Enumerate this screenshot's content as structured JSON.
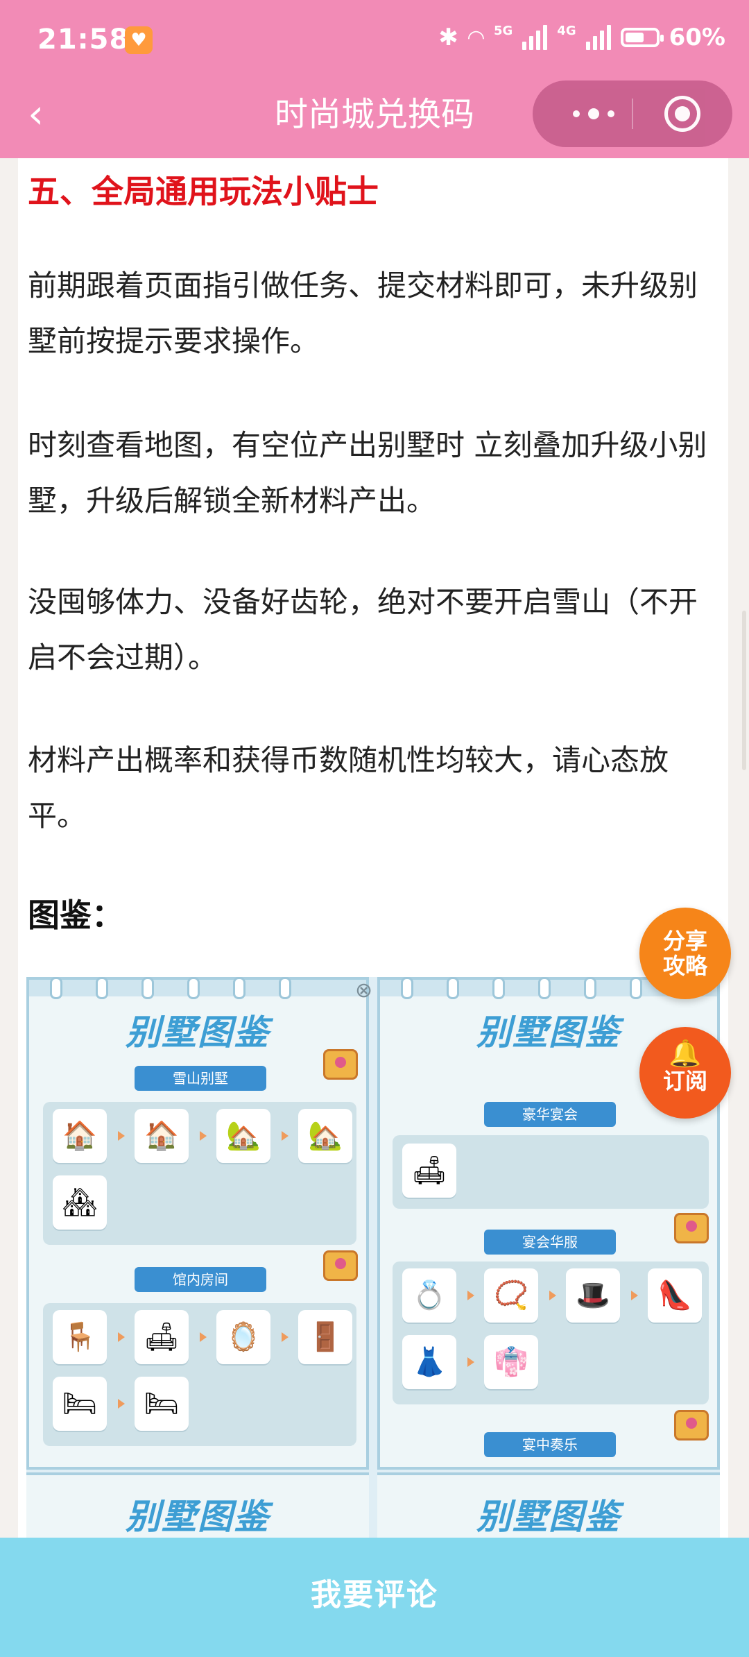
{
  "status_bar": {
    "time": "21:58",
    "net5g": "5G",
    "net4g": "4G",
    "battery": "60%",
    "notif_icon": "heart-icon"
  },
  "nav": {
    "back_icon": "back-arrow-icon",
    "title": "时尚城兑换码",
    "more_icon": "more-dots-icon",
    "close_icon": "target-close-icon"
  },
  "article": {
    "heading": "五、全局通用玩法小贴士",
    "paragraphs": [
      "前期跟着页面指引做任务、提交材料即可，未升级别墅前按提示要求操作。",
      "时刻查看地图，有空位产出别墅时 立刻叠加升级小别墅，升级后解锁全新材料产出。",
      "没囤够体力、没备好齿轮，绝对不要开启雪山（不开启不会过期）。",
      "材料产出概率和获得币数随机性均较大，请心态放平。"
    ],
    "subheading": "图鉴："
  },
  "gallery": {
    "panel_title": "别墅图鉴",
    "left": {
      "sections": [
        "雪山别墅",
        "馆内房间"
      ]
    },
    "right": {
      "sections": [
        "豪华宴会",
        "宴会华服",
        "宴中奏乐"
      ]
    }
  },
  "fabs": {
    "share": "分享攻略",
    "subscribe": "订阅",
    "subscribe_icon": "bell-icon"
  },
  "footer": {
    "comment": "我要评论"
  },
  "colors": {
    "topbar": "#f28bb6",
    "heading_red": "#e0131b",
    "footer": "#84d9ee",
    "fab_share": "#f68519",
    "fab_sub": "#f25a1e"
  }
}
